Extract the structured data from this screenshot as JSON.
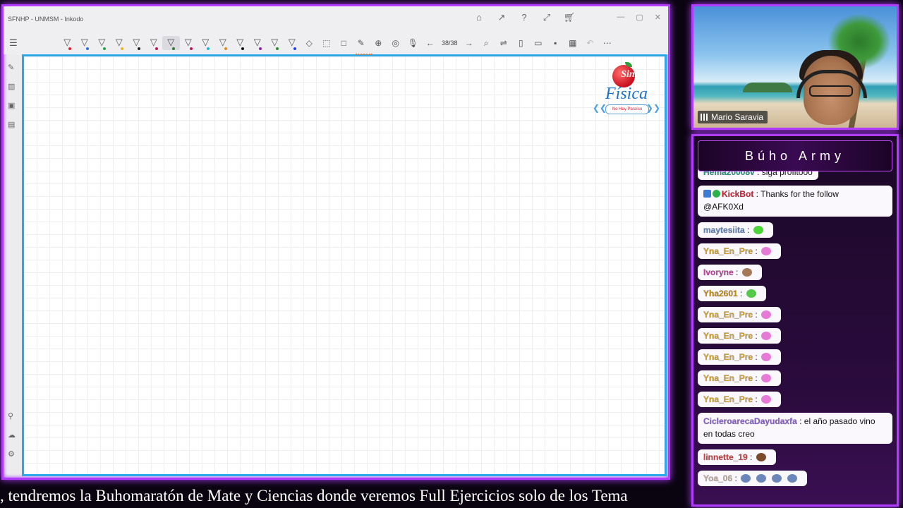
{
  "app": {
    "window_title": "SFNHP - UNMSM - Inkodo",
    "page_indicator": "38/38"
  },
  "toolbar": {
    "pen_colors": [
      "#e0242c",
      "#2f6fe0",
      "#22a640",
      "#e7b822",
      "#222222",
      "#c2185b",
      "#2e7d32",
      "#c2185b",
      "#1abcd8",
      "#e88b1c",
      "#111111",
      "#8e24aa",
      "#2e8b2e",
      "#1e40ff"
    ]
  },
  "logo": {
    "top": "Sin",
    "main": "Física",
    "sub": "No Hay Paraíso"
  },
  "webcam": {
    "name": "Mario Saravia"
  },
  "chat": {
    "title": "Búho Army",
    "messages": [
      {
        "user": "Hema20008v",
        "user_color": "#1e9b82",
        "text": "siga profitooo",
        "emote": "",
        "multiline": false
      },
      {
        "user": "KickBot",
        "user_color": "#d6182b",
        "text": "Thanks for the follow",
        "text2": "@AFK0Xd",
        "emote": "",
        "multiline": true
      },
      {
        "user": "maytesiita",
        "user_color": "#5a7fbf",
        "text": "",
        "emote": "#4cd43a",
        "multiline": false
      },
      {
        "user": "Yna_En_Pre",
        "user_color": "#e0a61a",
        "text": "",
        "emote": "#e57bd6",
        "multiline": false
      },
      {
        "user": "Ivoryne",
        "user_color": "#c53a9a",
        "text": "",
        "emote": "#a57858",
        "multiline": false
      },
      {
        "user": "Yha2601",
        "user_color": "#c98a00",
        "text": "",
        "emote": "#55c94a",
        "multiline": false
      },
      {
        "user": "Yna_En_Pre",
        "user_color": "#e0a61a",
        "text": "",
        "emote": "#e57bd6",
        "multiline": false
      },
      {
        "user": "Yna_En_Pre",
        "user_color": "#e0a61a",
        "text": "",
        "emote": "#e57bd6",
        "multiline": false
      },
      {
        "user": "Yna_En_Pre",
        "user_color": "#e0a61a",
        "text": "",
        "emote": "#e57bd6",
        "multiline": false
      },
      {
        "user": "Yna_En_Pre",
        "user_color": "#e0a61a",
        "text": "",
        "emote": "#e57bd6",
        "multiline": false
      },
      {
        "user": "Yna_En_Pre",
        "user_color": "#e0a61a",
        "text": "",
        "emote": "#e57bd6",
        "multiline": false
      },
      {
        "user": "CicleroarecaDayudaxfa",
        "user_color": "#8a5ad8",
        "text": "el año pasado vino",
        "text2": "en todas creo",
        "emote": "",
        "multiline": true
      },
      {
        "user": "linnette_19",
        "user_color": "#d03a3a",
        "text": "",
        "emote": "#7a4a2a",
        "multiline": false
      },
      {
        "user": "Yoa_06",
        "user_color": "#c8b2a0",
        "text": "",
        "emote": "#6b86b8",
        "multiline": false,
        "emote_count": 4
      }
    ]
  },
  "ticker": {
    "text": ", tendremos la Buhomaratón de Mate y Ciencias donde veremos Full Ejercicios solo de los Tema"
  }
}
